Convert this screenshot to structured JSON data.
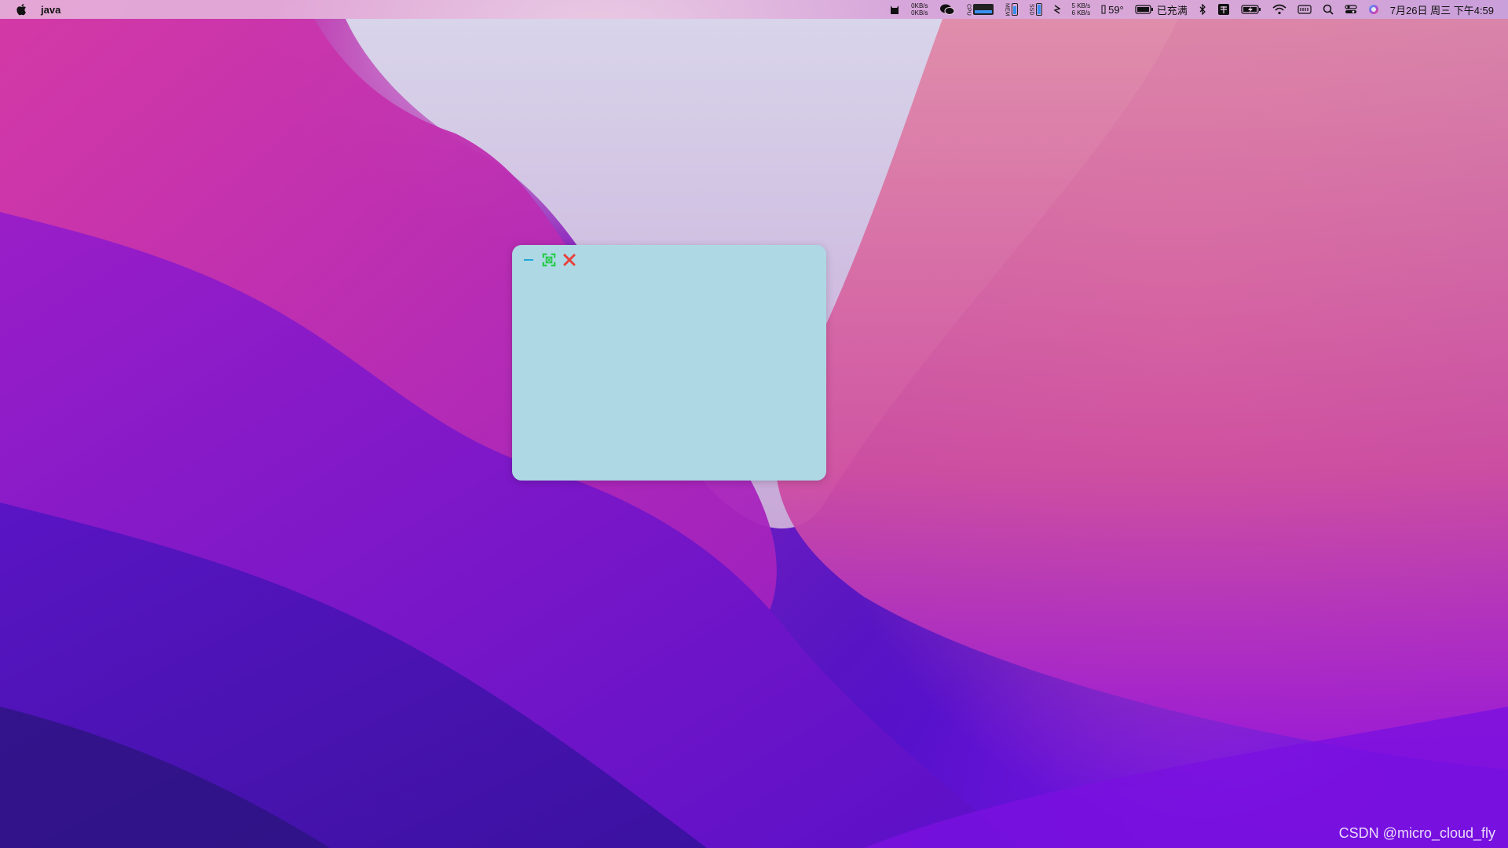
{
  "menubar": {
    "app_name": "java",
    "net_speed_1": {
      "up": "0KB/s",
      "down": "0KB/s"
    },
    "net_speed_2": {
      "up": "5 KB/s",
      "down": "6 KB/s"
    },
    "temperature": "59°",
    "battery_status": "已充满",
    "clock": "7月26日 周三 下午4:59",
    "meter_labels": [
      "CPU",
      "MEM",
      "SSD"
    ],
    "icons": [
      "apple-icon",
      "cat-icon",
      "wechat-icon",
      "cpu-meter-icon",
      "memory-meter-icon",
      "disk-meter-icon",
      "sensor-icon",
      "fan-icon",
      "battery-icon",
      "bluetooth-icon",
      "input-method-icon",
      "battery-charging-icon",
      "wifi-icon",
      "keyboard-icon",
      "search-icon",
      "control-center-icon",
      "siri-icon"
    ]
  },
  "window": {
    "background": "#add8e4",
    "controls": [
      "minimize-icon",
      "maximize-icon",
      "close-icon"
    ],
    "control_colors": {
      "minimize": "#1fa8d8",
      "maximize": "#22cc44",
      "close": "#e8413a"
    }
  },
  "watermark": "CSDN @micro_cloud_fly"
}
